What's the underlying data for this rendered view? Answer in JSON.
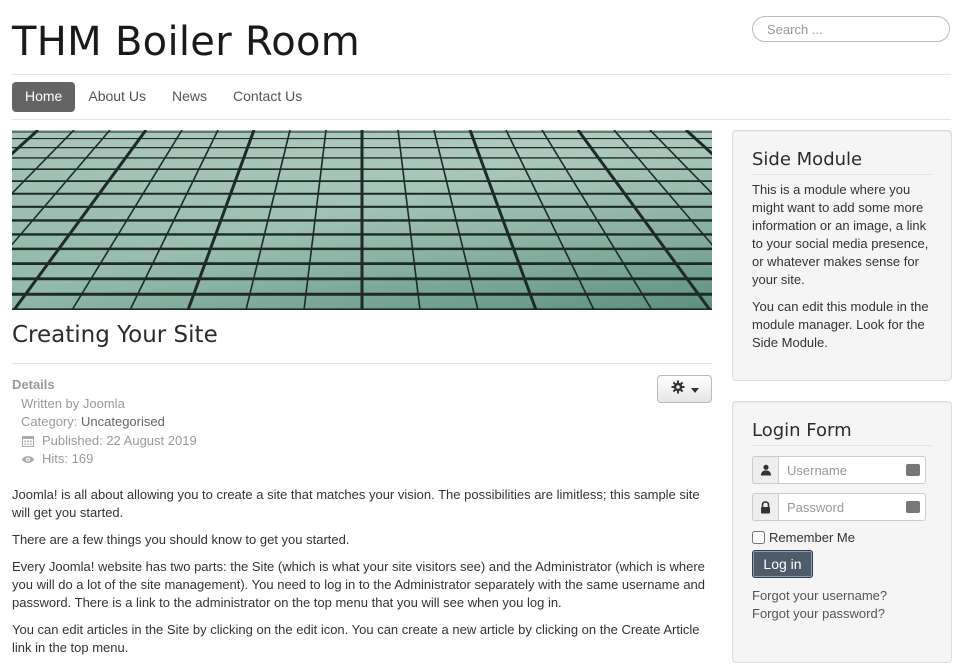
{
  "header": {
    "site_title": "THM Boiler Room",
    "search_placeholder": "Search ..."
  },
  "nav": {
    "items": [
      "Home",
      "About Us",
      "News",
      "Contact Us"
    ],
    "active": "Home"
  },
  "article": {
    "title": "Creating Your Site",
    "details": {
      "heading": "Details",
      "written_by": "Written by Joomla",
      "category_label": "Category: ",
      "category": "Uncategorised",
      "published": "Published: 22 August 2019",
      "hits": "Hits: 169"
    },
    "paragraphs": [
      "Joomla! is all about allowing you to create a site that matches your vision. The possibilities are limitless; this sample site will get you started.",
      "There are a few things you should know to get you started.",
      "Every Joomla! website has two parts: the Site (which is what your site visitors see) and the Administrator (which is where you will do a lot of the site management). You need to log in to the Administrator separately with the same username and password. There is a link to the administrator on the top menu that you will see when you log in.",
      "You can edit articles in the Site by clicking on the edit icon. You can create a new article by clicking on the Create Article link in the top menu."
    ]
  },
  "side_module": {
    "title": "Side Module",
    "paragraphs": [
      "This is a module where you might want to add some more information or an image, a link to your social media presence, or whatever makes sense for your site.",
      "You can edit this module in the module manager. Look for the Side Module."
    ]
  },
  "login": {
    "title": "Login Form",
    "username_placeholder": "Username",
    "password_placeholder": "Password",
    "remember_label": "Remember Me",
    "button_label": "Log in",
    "forgot_username": "Forgot your username?",
    "forgot_password": "Forgot your password?"
  },
  "icons": {
    "gear": "gear-icon",
    "caret": "caret-down-icon",
    "calendar": "calendar-icon",
    "eye": "eye-icon",
    "user": "user-icon",
    "lock": "lock-icon",
    "keyboard": "keyboard-icon"
  },
  "colors": {
    "nav_active_bg": "#646464",
    "login_button_bg": "#4e5b6a",
    "well_bg": "#f5f5f5"
  }
}
